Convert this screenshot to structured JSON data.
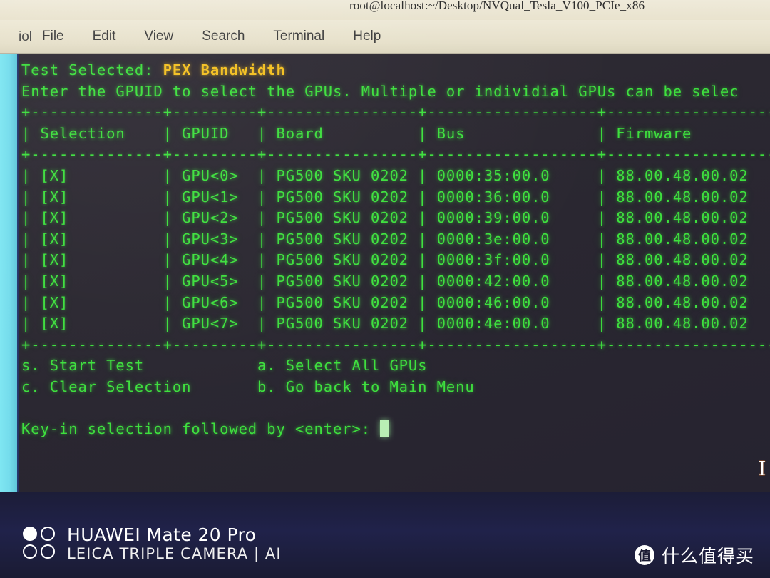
{
  "window": {
    "title": "root@localhost:~/Desktop/NVQual_Tesla_V100_PCIe_x86",
    "clipped_left_label": "iol",
    "menu": [
      {
        "label": "File"
      },
      {
        "label": "Edit"
      },
      {
        "label": "View"
      },
      {
        "label": "Search"
      },
      {
        "label": "Terminal"
      },
      {
        "label": "Help"
      }
    ]
  },
  "terminal": {
    "test_selected_label": "Test Selected: ",
    "test_selected_value": "PEX Bandwidth",
    "instruction": "Enter the GPUID to select the GPUs. Multiple or individial GPUs can be selec",
    "separator": "+--------------+---------+----------------+------------------+-------------------+",
    "header": {
      "selection": "Selection",
      "gpuid": "GPUID",
      "board": "Board",
      "bus": "Bus",
      "firmware": "Firmware"
    },
    "rows": [
      {
        "selection": "[X]",
        "gpuid": "GPU<0>",
        "board": "PG500 SKU 0202",
        "bus": "0000:35:00.0",
        "firmware": "88.00.48.00.02"
      },
      {
        "selection": "[X]",
        "gpuid": "GPU<1>",
        "board": "PG500 SKU 0202",
        "bus": "0000:36:00.0",
        "firmware": "88.00.48.00.02"
      },
      {
        "selection": "[X]",
        "gpuid": "GPU<2>",
        "board": "PG500 SKU 0202",
        "bus": "0000:39:00.0",
        "firmware": "88.00.48.00.02"
      },
      {
        "selection": "[X]",
        "gpuid": "GPU<3>",
        "board": "PG500 SKU 0202",
        "bus": "0000:3e:00.0",
        "firmware": "88.00.48.00.02"
      },
      {
        "selection": "[X]",
        "gpuid": "GPU<4>",
        "board": "PG500 SKU 0202",
        "bus": "0000:3f:00.0",
        "firmware": "88.00.48.00.02"
      },
      {
        "selection": "[X]",
        "gpuid": "GPU<5>",
        "board": "PG500 SKU 0202",
        "bus": "0000:42:00.0",
        "firmware": "88.00.48.00.02"
      },
      {
        "selection": "[X]",
        "gpuid": "GPU<6>",
        "board": "PG500 SKU 0202",
        "bus": "0000:46:00.0",
        "firmware": "88.00.48.00.02"
      },
      {
        "selection": "[X]",
        "gpuid": "GPU<7>",
        "board": "PG500 SKU 0202",
        "bus": "0000:4e:00.0",
        "firmware": "88.00.48.00.02"
      }
    ],
    "menu_options": {
      "start_test": "s. Start Test",
      "select_all": "a. Select All GPUs",
      "clear_selection": "c. Clear Selection",
      "go_back": "b. Go back to Main Menu"
    },
    "prompt": "Key-in selection followed by <enter>: ",
    "prompt_value": ""
  },
  "watermark": {
    "phone_model": "HUAWEI Mate 20 Pro",
    "camera_tagline": "LEICA TRIPLE CAMERA | AI",
    "site_badge": "值",
    "site_name": "什么值得买"
  },
  "colors": {
    "terminal_green": "#3ee03e",
    "highlight_yellow": "#f4c020",
    "terminal_bg": "#2b2831",
    "menubar_bg": "#e8e2cd",
    "ambient_navy": "#1e2044",
    "left_strip_cyan": "#74dcec"
  }
}
